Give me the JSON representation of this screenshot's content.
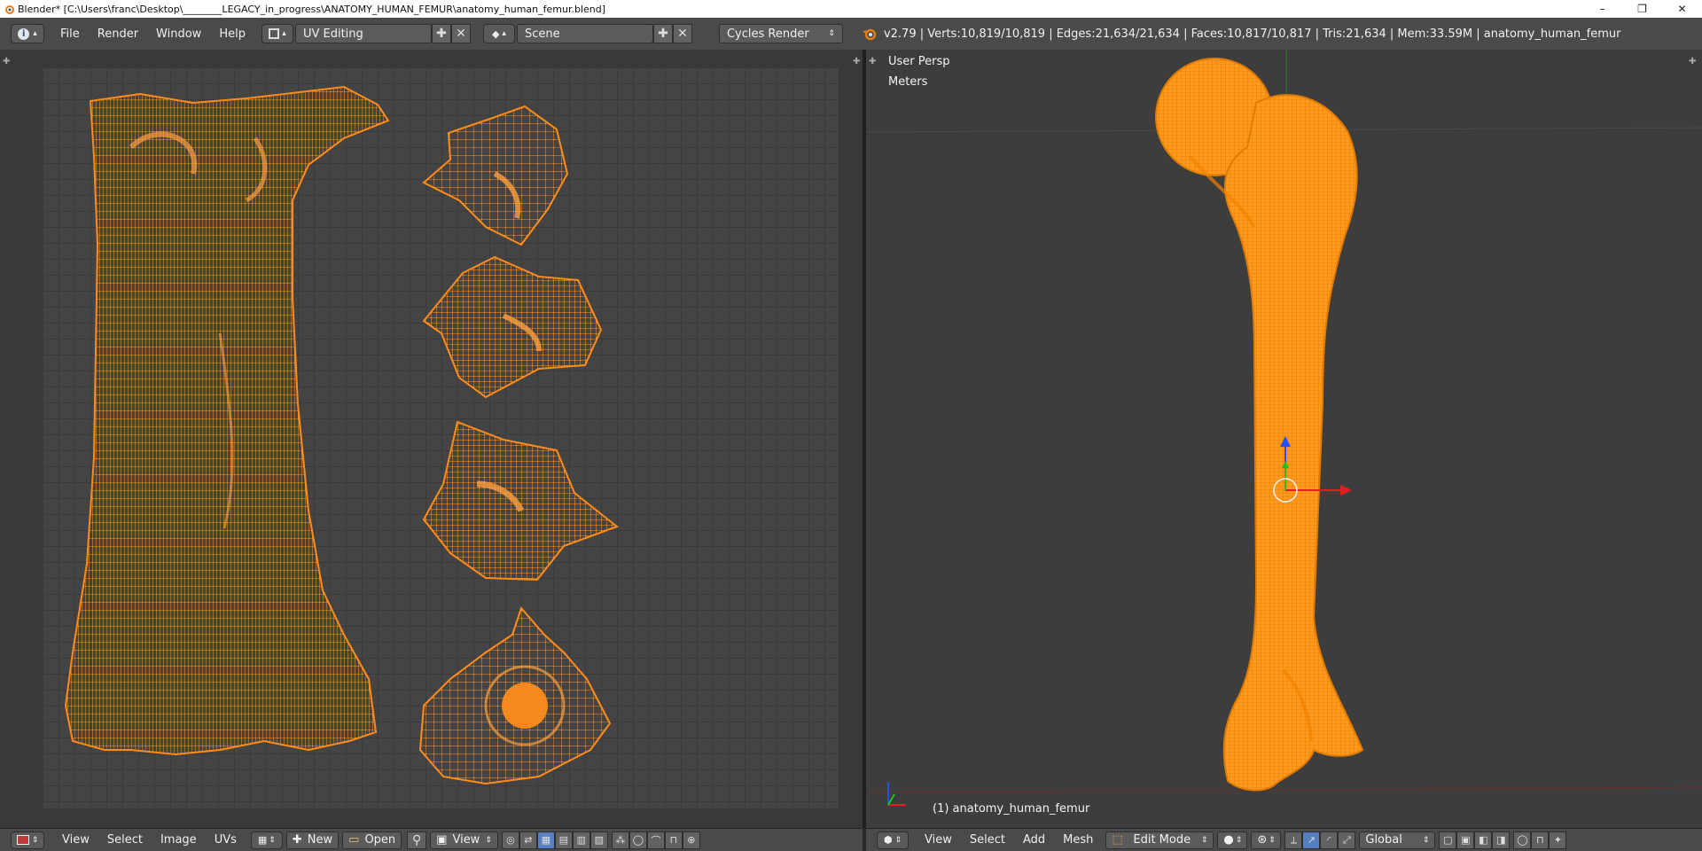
{
  "titlebar": {
    "title": "Blender* [C:\\Users\\franc\\Desktop\\________LEGACY_in_progress\\ANATOMY_HUMAN_FEMUR\\anatomy_human_femur.blend]",
    "controls": [
      "–",
      "❐",
      "✕"
    ]
  },
  "info_header": {
    "menu": [
      "File",
      "Render",
      "Window",
      "Help"
    ],
    "screen_layout": "UV Editing",
    "scene": "Scene",
    "render_engine": "Cycles Render",
    "stats": "v2.79 | Verts:10,819/10,819 | Edges:21,634/21,634 | Faces:10,817/10,817 | Tris:21,634 | Mem:33.59M | anatomy_human_femur"
  },
  "viewport": {
    "view_name": "User Persp",
    "units": "Meters",
    "object_label": "(1) anatomy_human_femur"
  },
  "uv_header": {
    "menu": [
      "View",
      "Select",
      "Image",
      "UVs"
    ],
    "new_label": "New",
    "open_label": "Open",
    "view_label": "View"
  },
  "view3d_header": {
    "menu": [
      "View",
      "Select",
      "Add",
      "Mesh"
    ],
    "mode": "Edit Mode",
    "orientation": "Global"
  },
  "colors": {
    "mesh": "#ff8c1a",
    "mesh_dark": "#c85f00",
    "axis_x": "#e02020",
    "axis_y": "#20c020",
    "axis_z": "#2050ff"
  },
  "icons": {
    "blender_logo": "blender-icon",
    "info_editor": "info-icon",
    "screen": "screen-layout-icon",
    "scene": "scene-icon",
    "add": "plus-icon",
    "remove": "close-icon"
  }
}
